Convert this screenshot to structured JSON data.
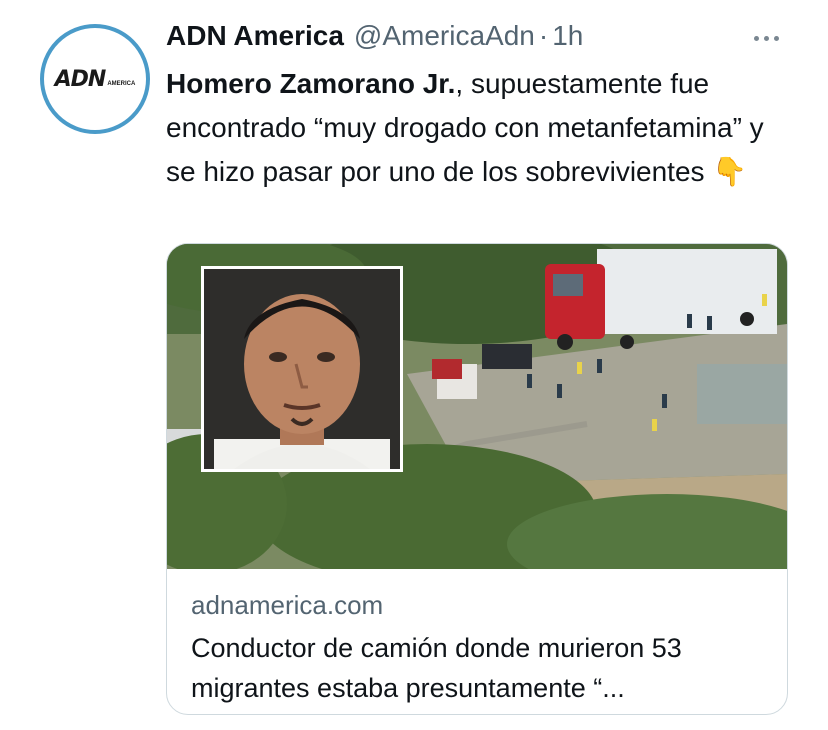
{
  "author": {
    "name": "ADN America",
    "handle": "@AmericaAdn",
    "separator": "·",
    "time": "1h",
    "avatar_logo": "ADN",
    "avatar_logo_sub": "AMERICA"
  },
  "tweet": {
    "bold_text": "Homero Zamorano Jr.",
    "text": ", supuestamente fue encontrado “muy drogado con metanfetamina” y se hizo pasar por uno de los sobrevivientes",
    "emoji": "👇"
  },
  "card": {
    "domain": "adnamerica.com",
    "title": "Conductor de camión donde murieron 53 migrantes estaba presuntamente “..."
  },
  "icons": {
    "more": "more-horizontal-icon"
  },
  "colors": {
    "avatar_ring": "#4a9bc9",
    "secondary_text": "#536471",
    "card_border": "#cfd9de"
  }
}
